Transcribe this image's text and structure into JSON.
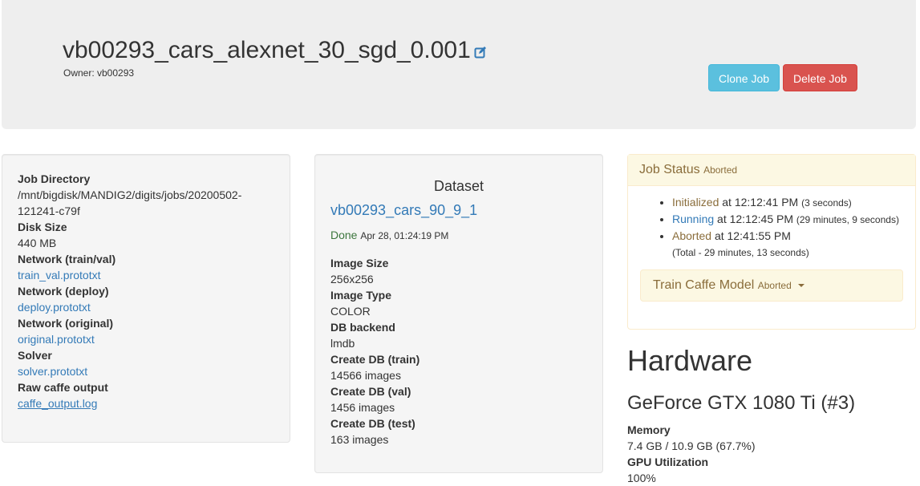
{
  "header": {
    "title": "vb00293_cars_alexnet_30_sgd_0.001",
    "owner": "Owner: vb00293",
    "clone_label": "Clone Job",
    "delete_label": "Delete Job"
  },
  "job_info": [
    {
      "label": "Job Directory",
      "value": "/mnt/bigdisk/MANDIG2/digits/jobs/20200502-121241-c79f",
      "type": "text"
    },
    {
      "label": "Disk Size",
      "value": "440 MB",
      "type": "text"
    },
    {
      "label": "Network (train/val)",
      "value": "train_val.prototxt",
      "type": "link"
    },
    {
      "label": "Network (deploy)",
      "value": "deploy.prototxt",
      "type": "link"
    },
    {
      "label": "Network (original)",
      "value": "original.prototxt",
      "type": "link"
    },
    {
      "label": "Solver",
      "value": "solver.prototxt",
      "type": "link"
    },
    {
      "label": "Raw caffe output",
      "value": "caffe_output.log",
      "type": "underline"
    }
  ],
  "dataset": {
    "heading": "Dataset",
    "name": "vb00293_cars_90_9_1",
    "status": "Done",
    "status_date": "Apr 28, 01:24:19 PM",
    "fields": [
      {
        "label": "Image Size",
        "value": "256x256"
      },
      {
        "label": "Image Type",
        "value": "COLOR"
      },
      {
        "label": "DB backend",
        "value": "lmdb"
      },
      {
        "label": "Create DB (train)",
        "value": "14566 images"
      },
      {
        "label": "Create DB (val)",
        "value": "1456 images"
      },
      {
        "label": "Create DB (test)",
        "value": "163 images"
      }
    ]
  },
  "job_status": {
    "title": "Job Status",
    "state": "Aborted",
    "events": [
      {
        "name": "Initialized",
        "at": "at 12:12:41 PM",
        "duration": "(3 seconds)"
      },
      {
        "name": "Running",
        "at": "at 12:12:45 PM",
        "duration": "(29 minutes, 9 seconds)"
      },
      {
        "name": "Aborted",
        "at": "at 12:41:55 PM",
        "duration": ""
      }
    ],
    "total": "(Total - 29 minutes, 13 seconds)",
    "task_name": "Train Caffe Model",
    "task_state": "Aborted"
  },
  "hardware": {
    "heading": "Hardware",
    "gpu": "GeForce GTX 1080 Ti (#3)",
    "memory_label": "Memory",
    "memory_value": "7.4 GB / 10.9 GB (67.7%)",
    "util_label": "GPU Utilization",
    "util_value": "100%"
  },
  "colors": {
    "link": "#337ab7",
    "clone_btn": "#5bc0de",
    "delete_btn": "#d9534f",
    "warning_bg": "#fcf8e3",
    "warning_text": "#8a6d3b",
    "done": "#3c763d"
  },
  "icons": {
    "edit": "edit-icon",
    "dropdown": "caret-down-icon"
  }
}
